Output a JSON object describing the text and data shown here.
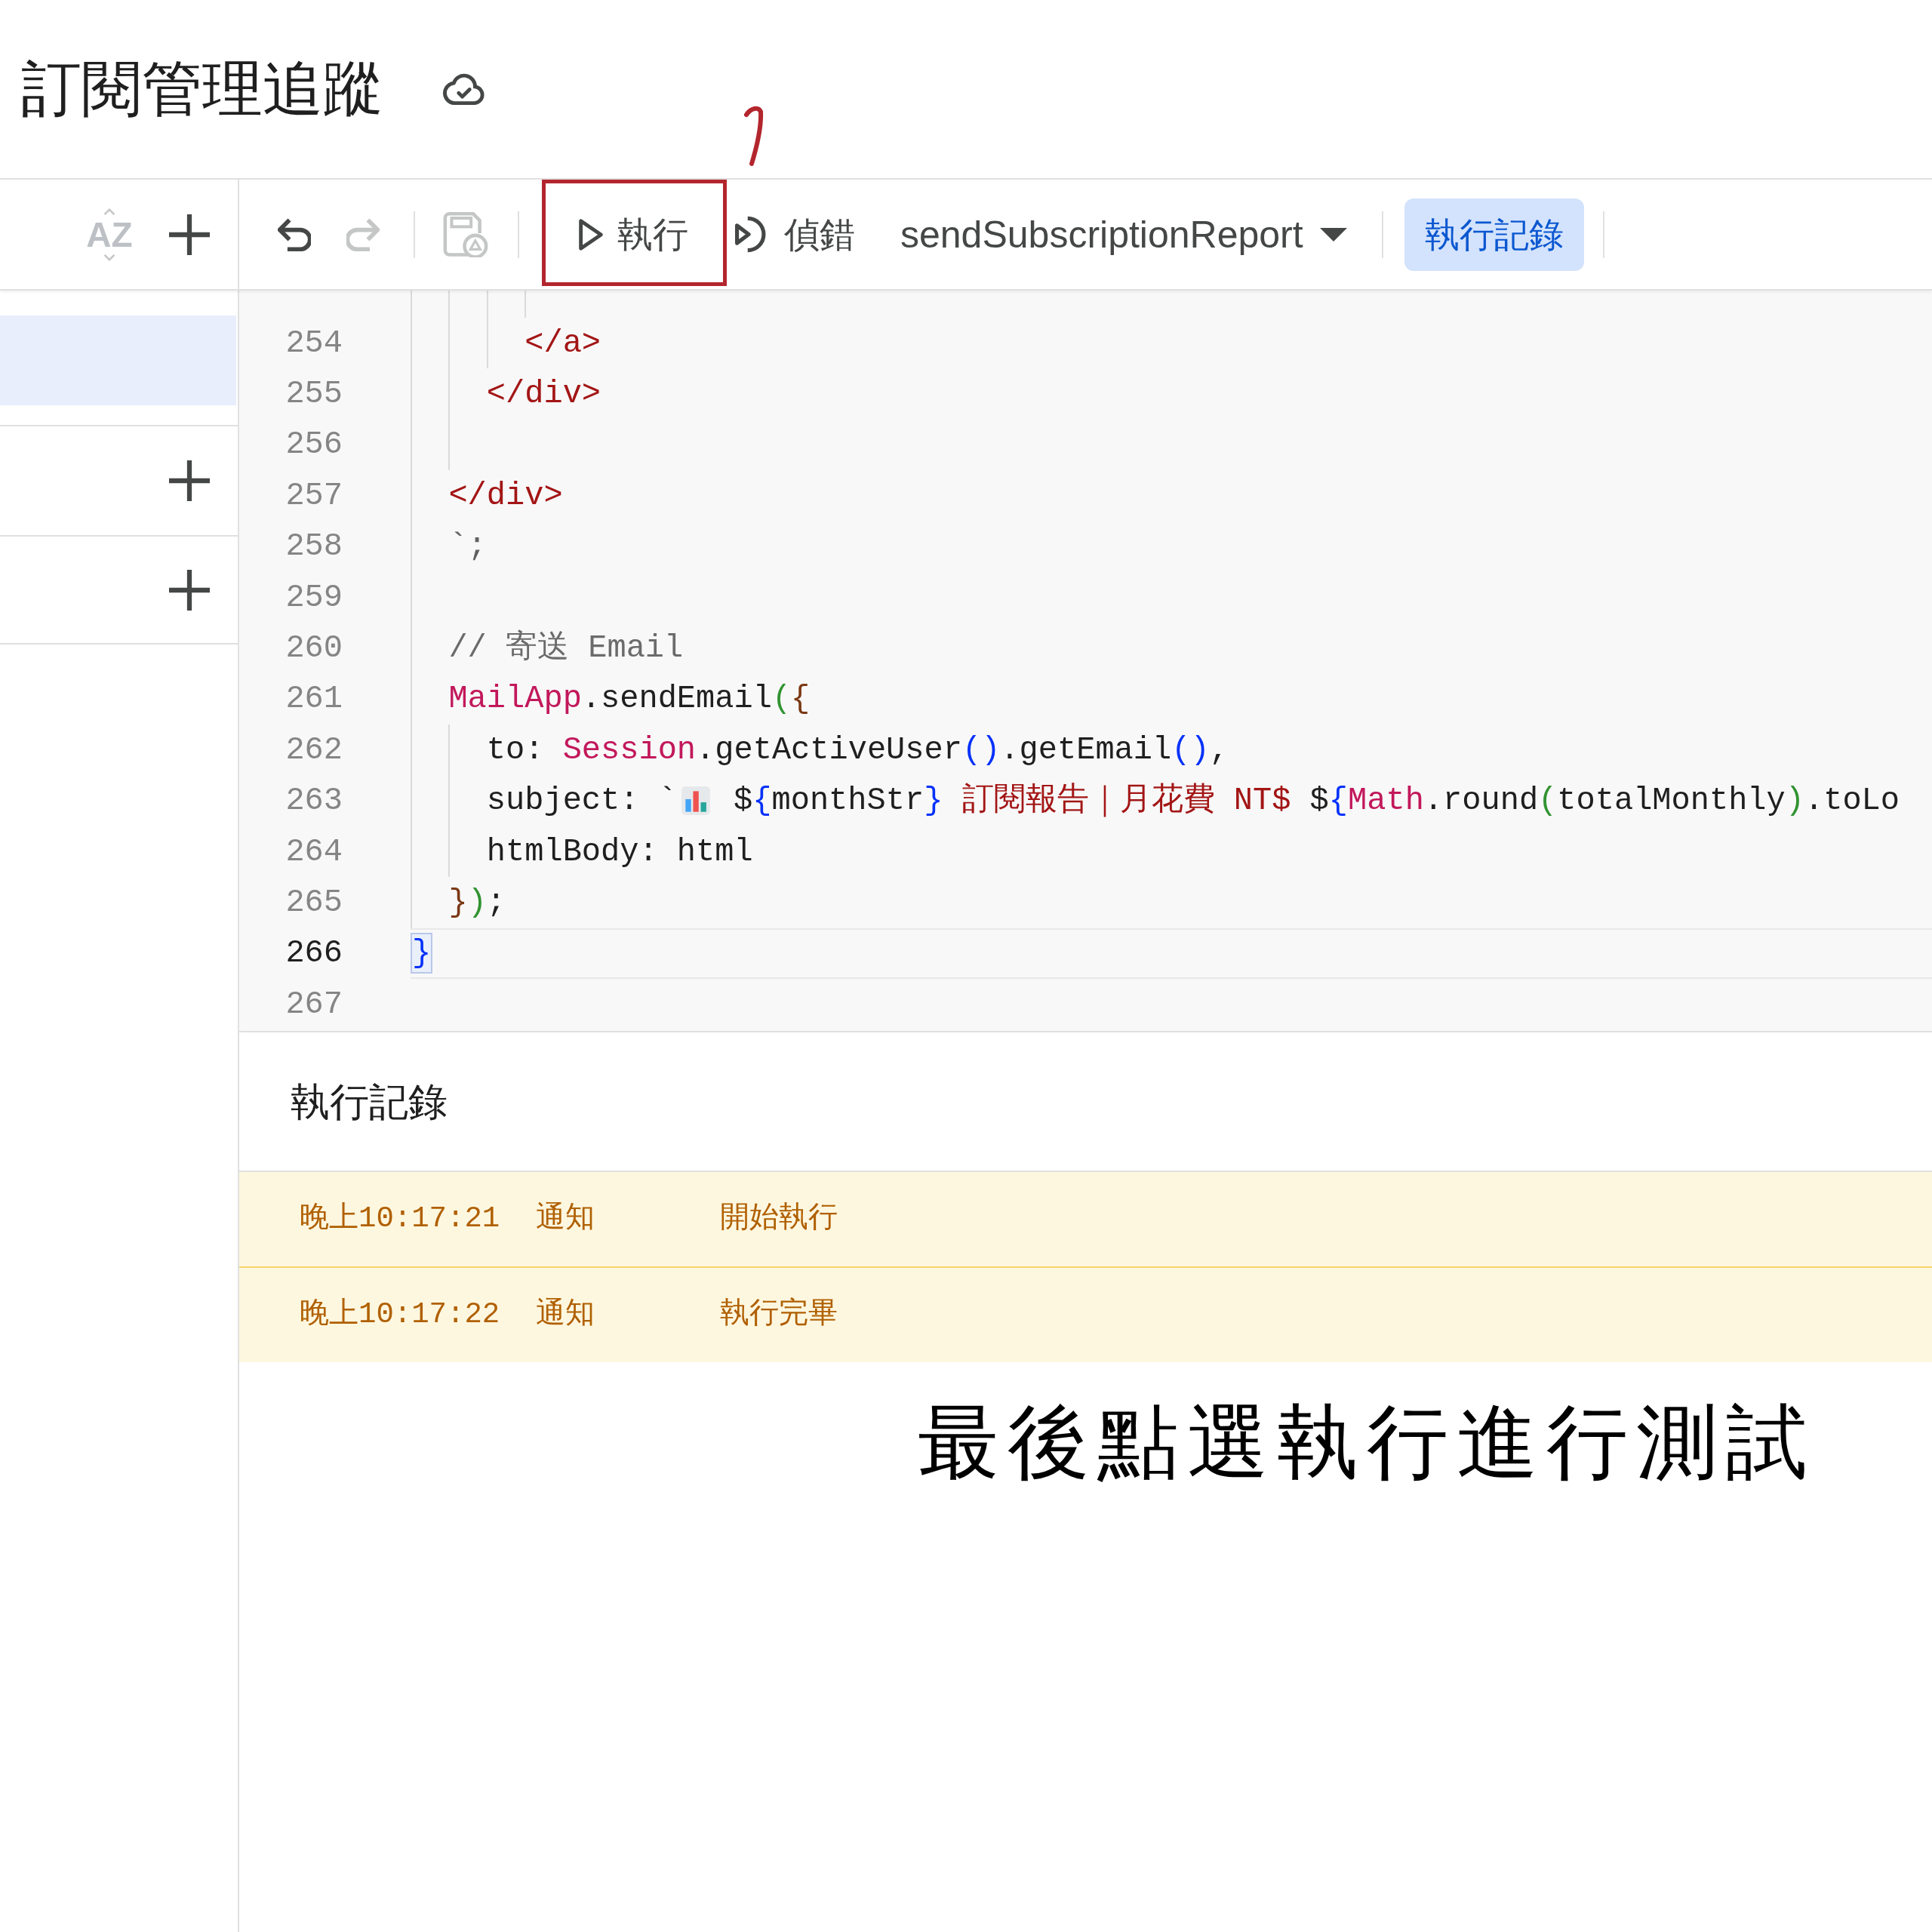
{
  "header": {
    "title": "訂閱管理追蹤",
    "saved": true
  },
  "toolbar": {
    "sort": {
      "label": "AZ",
      "disabled": true
    },
    "undo": {
      "disabled": false
    },
    "redo": {
      "disabled": true
    },
    "save": {
      "disabled": true
    },
    "run": {
      "label": "執行"
    },
    "debug": {
      "label": "偵錯"
    },
    "function_select": {
      "value": "sendSubscriptionReport"
    },
    "log_toggle": {
      "label": "執行記錄",
      "selected": true
    }
  },
  "sidebar": {
    "files": [
      {
        "selected": true
      }
    ]
  },
  "editor": {
    "lines": [
      {
        "number": "254",
        "current": false,
        "bracket_match": false,
        "tokens": [
          {
            "kind": "string",
            "text": "      </a>"
          }
        ]
      },
      {
        "number": "255",
        "current": false,
        "bracket_match": false,
        "tokens": [
          {
            "kind": "string",
            "text": "    </div>"
          }
        ]
      },
      {
        "number": "256",
        "current": false,
        "bracket_match": false
      },
      {
        "number": "257",
        "current": false,
        "bracket_match": false,
        "tokens": [
          {
            "kind": "string",
            "text": "  </div>"
          }
        ]
      },
      {
        "number": "258",
        "current": false,
        "bracket_match": false,
        "tokens": [
          {
            "kind": "punct",
            "text": "  `;"
          }
        ]
      },
      {
        "number": "259",
        "current": false,
        "bracket_match": false
      },
      {
        "number": "260",
        "current": false,
        "bracket_match": false,
        "tokens": [
          {
            "kind": "comment",
            "text": "  // 寄送 Email"
          }
        ]
      },
      {
        "number": "261",
        "current": false,
        "bracket_match": false,
        "tokens": [
          {
            "kind": "type",
            "text": "  MailApp"
          },
          {
            "kind": "plain",
            "text": ".sendEmail"
          },
          {
            "kind": "bracket",
            "text": "(",
            "color": "#319331"
          },
          {
            "kind": "bracket",
            "text": "{",
            "color": "#7b3814"
          }
        ]
      },
      {
        "number": "262",
        "current": false,
        "bracket_match": false,
        "tokens": [
          {
            "kind": "plain",
            "text": "    to: "
          },
          {
            "kind": "type",
            "text": "Session"
          },
          {
            "kind": "plain",
            "text": ".getActiveUser"
          },
          {
            "kind": "bracket",
            "text": "()",
            "color": "#0431fa"
          },
          {
            "kind": "plain",
            "text": ".getEmail"
          },
          {
            "kind": "bracket",
            "text": "()",
            "color": "#0431fa"
          },
          {
            "kind": "plain",
            "text": ","
          }
        ]
      },
      {
        "number": "263",
        "current": false,
        "bracket_match": false,
        "tokens": [
          {
            "kind": "plain",
            "text": "    subject: `"
          },
          {
            "kind": "icon"
          },
          {
            "kind": "plain",
            "text": " $"
          },
          {
            "kind": "bracket",
            "text": "{",
            "color": "#0431fa"
          },
          {
            "kind": "plain",
            "text": "monthStr"
          },
          {
            "kind": "bracket",
            "text": "}",
            "color": "#0431fa"
          },
          {
            "kind": "string",
            "text": " 訂閱報告｜月花費 NT$ "
          },
          {
            "kind": "plain",
            "text": "$"
          },
          {
            "kind": "bracket",
            "text": "{",
            "color": "#0431fa"
          },
          {
            "kind": "type",
            "text": "Math"
          },
          {
            "kind": "plain",
            "text": ".round"
          },
          {
            "kind": "bracket",
            "text": "(",
            "color": "#319331"
          },
          {
            "kind": "plain",
            "text": "totalMonthly"
          },
          {
            "kind": "bracket",
            "text": ")",
            "color": "#319331"
          },
          {
            "kind": "plain",
            "text": ".toLo"
          }
        ]
      },
      {
        "number": "264",
        "current": false,
        "bracket_match": false,
        "tokens": [
          {
            "kind": "plain",
            "text": "    htmlBody: html"
          }
        ]
      },
      {
        "number": "265",
        "current": false,
        "bracket_match": false,
        "tokens": [
          {
            "kind": "bracket",
            "text": "  }",
            "color": "#7b3814"
          },
          {
            "kind": "bracket",
            "text": ")",
            "color": "#319331"
          },
          {
            "kind": "plain",
            "text": ";"
          }
        ]
      },
      {
        "number": "266",
        "current": true,
        "bracket_match": true,
        "tokens": [
          {
            "kind": "bracket",
            "text": "}",
            "color": "#0431fa"
          }
        ]
      },
      {
        "number": "267",
        "current": false,
        "bracket_match": false
      }
    ]
  },
  "log": {
    "title": "執行記錄",
    "entries": [
      {
        "kind": "notice",
        "time": "晚上10:17:21",
        "type": "通知",
        "message": "開始執行"
      },
      {
        "kind": "notice",
        "time": "晚上10:17:22",
        "type": "通知",
        "message": "執行完畢"
      }
    ]
  },
  "annotations": [
    {
      "kind": "frame"
    },
    {
      "kind": "hook"
    },
    {
      "kind": "note",
      "text": "最後點選執行進行測試"
    }
  ]
}
